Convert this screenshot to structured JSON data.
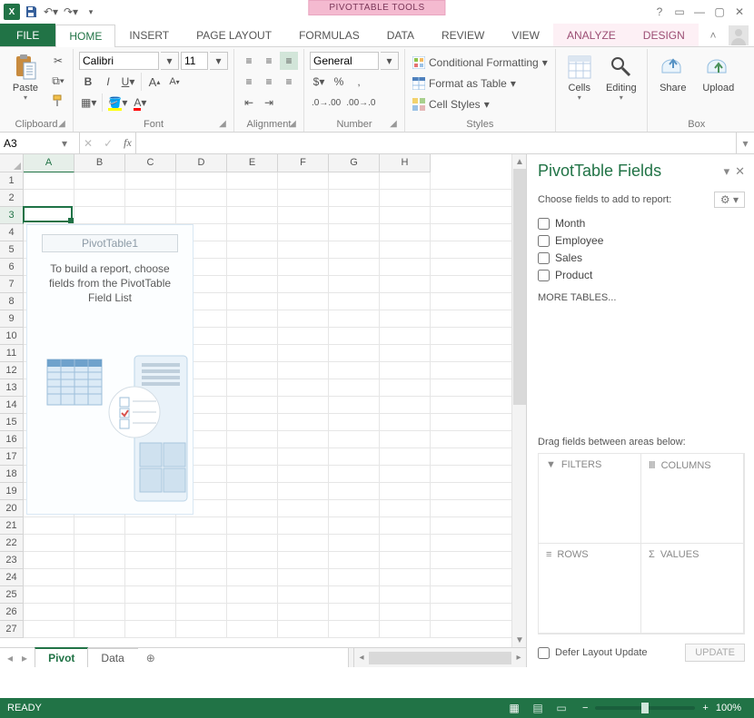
{
  "title_bar": {
    "context_tool_label": "PIVOTTABLE TOOLS"
  },
  "ribbon_tabs": {
    "file": "FILE",
    "home": "HOME",
    "insert": "INSERT",
    "page_layout": "PAGE LAYOUT",
    "formulas": "FORMULAS",
    "data": "DATA",
    "review": "REVIEW",
    "view": "VIEW",
    "analyze": "ANALYZE",
    "design": "DESIGN"
  },
  "ribbon": {
    "clipboard": {
      "label": "Clipboard",
      "paste": "Paste"
    },
    "font": {
      "label": "Font",
      "name": "Calibri",
      "size": "11"
    },
    "alignment": {
      "label": "Alignment"
    },
    "number": {
      "label": "Number",
      "format": "General"
    },
    "styles": {
      "label": "Styles",
      "cond_fmt": "Conditional Formatting",
      "as_table": "Format as Table",
      "cell_styles": "Cell Styles"
    },
    "cells": {
      "label": "Cells",
      "btn": "Cells"
    },
    "editing": {
      "label": "",
      "btn": "Editing"
    },
    "box": {
      "label": "Box",
      "share": "Share",
      "upload": "Upload"
    }
  },
  "name_box": {
    "value": "A3"
  },
  "grid": {
    "columns": [
      "A",
      "B",
      "C",
      "D",
      "E",
      "F",
      "G",
      "H"
    ],
    "row_count": 27,
    "selected_col_index": 0,
    "selected_row_index": 2
  },
  "pivot_placeholder": {
    "name": "PivotTable1",
    "msg_l1": "To build a report, choose",
    "msg_l2": "fields from the PivotTable",
    "msg_l3": "Field List"
  },
  "sheet_bar": {
    "tabs": [
      {
        "name": "Pivot",
        "active": true
      },
      {
        "name": "Data",
        "active": false
      }
    ]
  },
  "pivot_fields": {
    "title": "PivotTable Fields",
    "choose_label": "Choose fields to add to report:",
    "fields": [
      "Month",
      "Employee",
      "Sales",
      "Product"
    ],
    "more_tables": "MORE TABLES...",
    "drag_hint": "Drag fields between areas below:",
    "areas": {
      "filters": "FILTERS",
      "columns": "COLUMNS",
      "rows": "ROWS",
      "values": "VALUES"
    },
    "defer_label": "Defer Layout Update",
    "update_btn": "UPDATE"
  },
  "status": {
    "ready": "READY",
    "zoom": "100%"
  }
}
